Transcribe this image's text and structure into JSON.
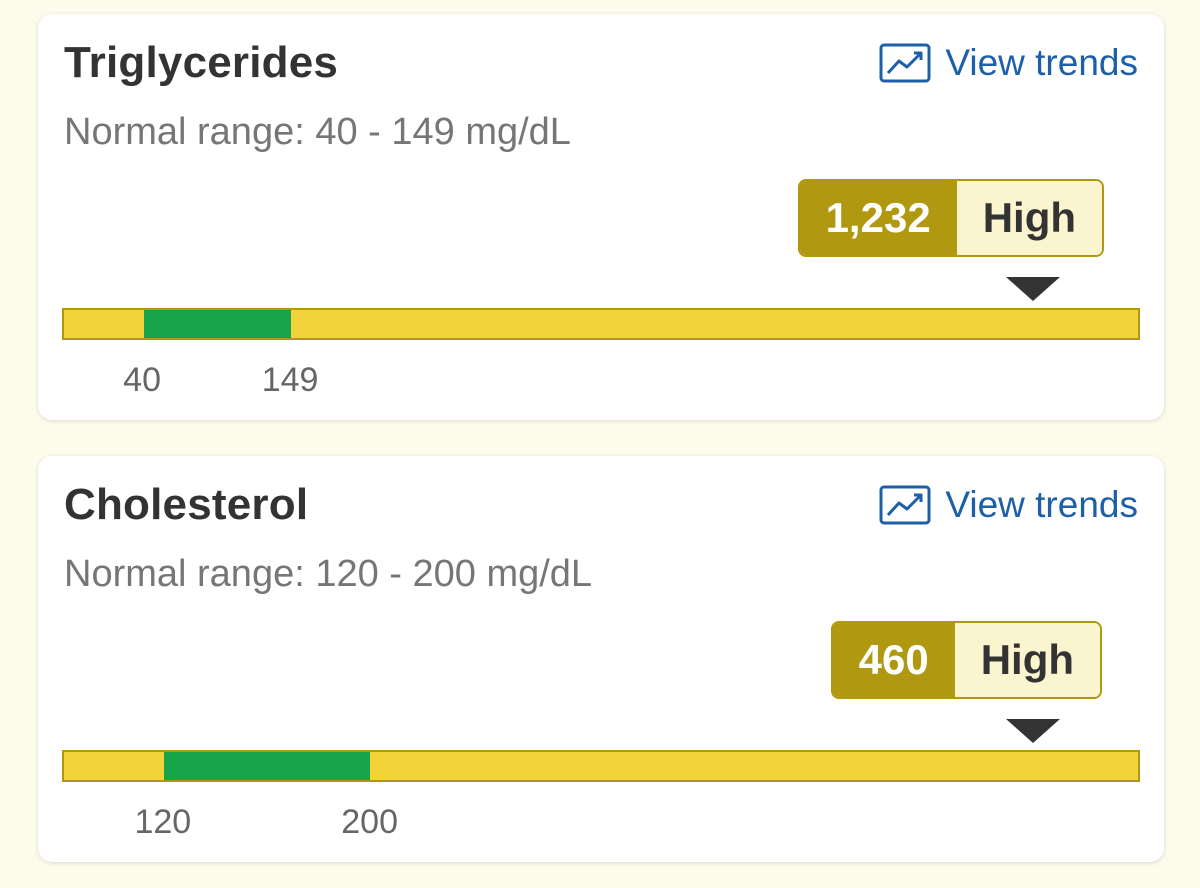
{
  "results": [
    {
      "title": "Triglycerides",
      "normal_range_text": "Normal range: 40 - 149 mg/dL",
      "view_trends_label": "View trends",
      "value": "1,232",
      "status": "High",
      "normal_low_label": "40",
      "normal_high_label": "149",
      "scale": {
        "normal_low": 40,
        "normal_high": 149,
        "scale_min": -19,
        "scale_max": 775,
        "value": 1232
      },
      "colors": {
        "out_of_range": "#f2d43a",
        "normal": "#16a34a",
        "badge": "#b09810",
        "badge_status_bg": "#faf4cf"
      }
    },
    {
      "title": "Cholesterol",
      "normal_range_text": "Normal range: 120 - 200 mg/dL",
      "view_trends_label": "View trends",
      "value": "460",
      "status": "High",
      "normal_low_label": "120",
      "normal_high_label": "200",
      "scale": {
        "normal_low": 120,
        "normal_high": 200,
        "scale_min": 81,
        "scale_max": 498,
        "value": 460
      },
      "colors": {
        "out_of_range": "#f2d43a",
        "normal": "#16a34a",
        "badge": "#b09810",
        "badge_status_bg": "#faf4cf"
      }
    }
  ],
  "icons": {
    "trends": "trend-chart-icon",
    "marker": "triangle-down-icon"
  }
}
